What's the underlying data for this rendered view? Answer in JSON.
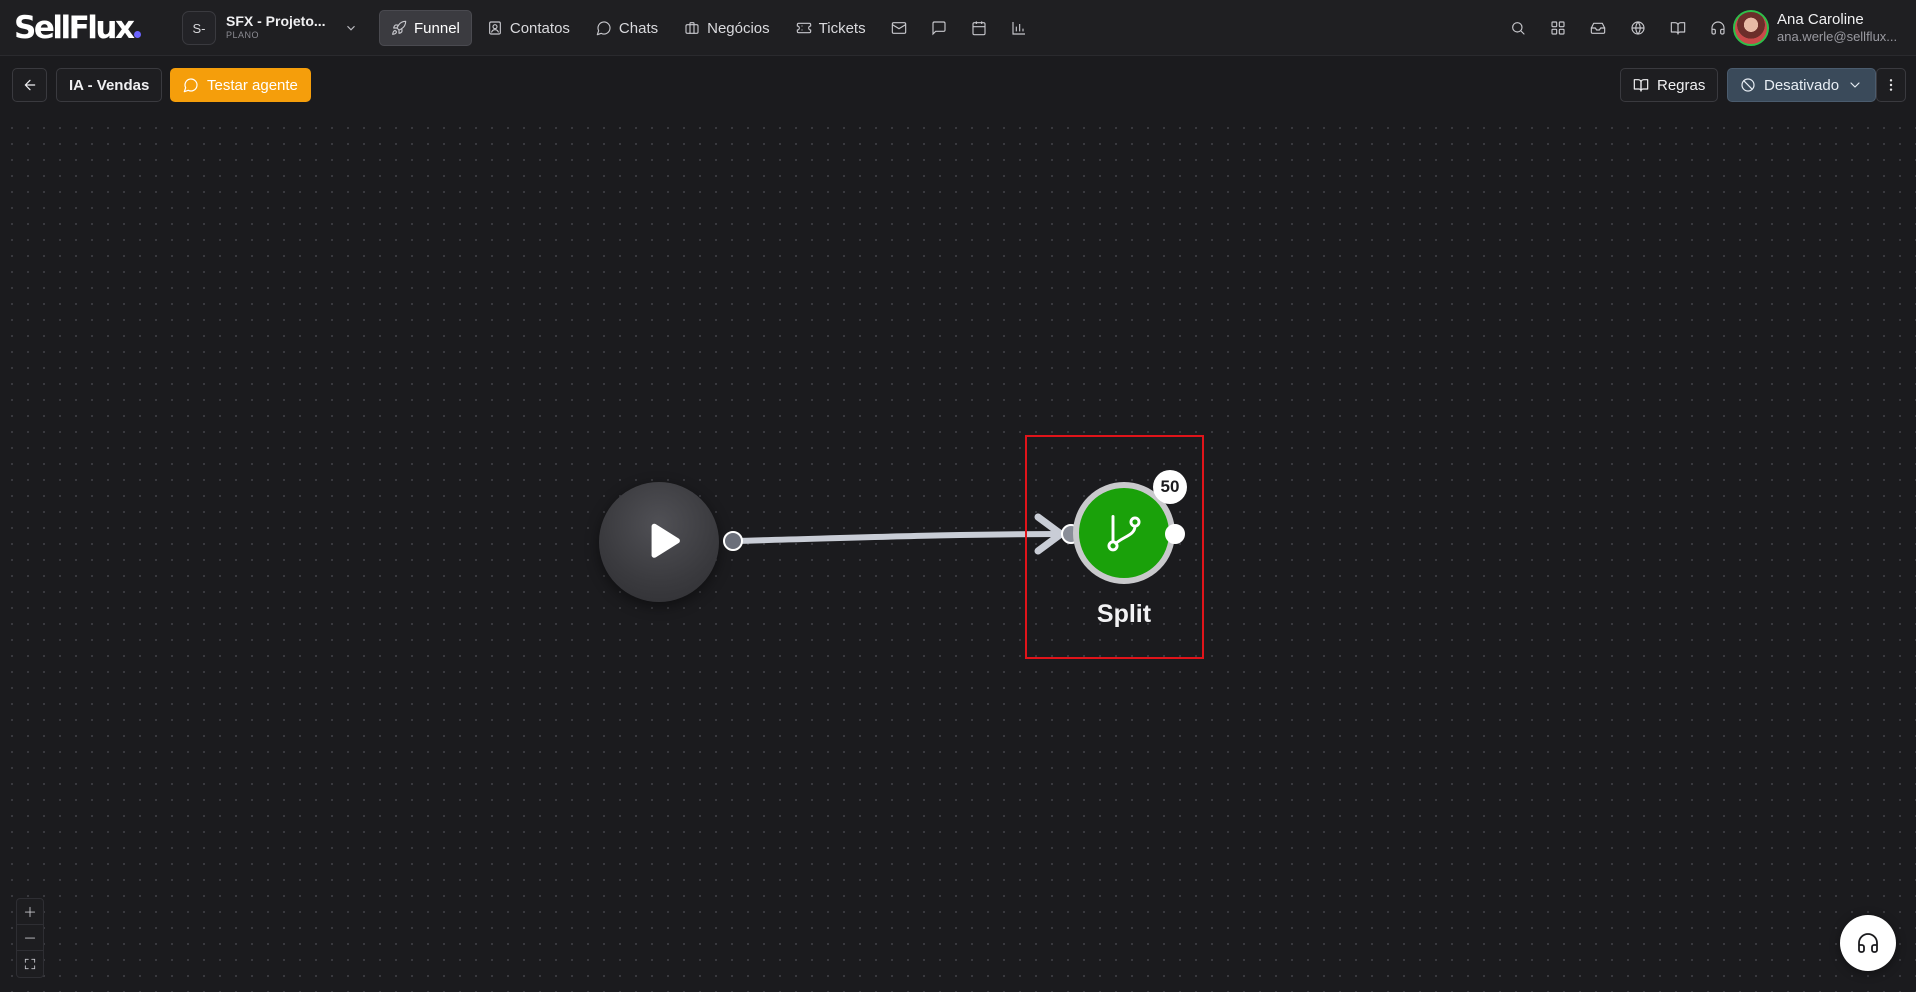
{
  "brand": {
    "logo_text": "SellFlux"
  },
  "workspace": {
    "initial": "S-",
    "name": "SFX - Projeto...",
    "plan": "PLANO"
  },
  "nav": {
    "items": [
      {
        "label": "Funnel",
        "icon": "rocket-icon",
        "active": true
      },
      {
        "label": "Contatos",
        "icon": "contacts-icon"
      },
      {
        "label": "Chats",
        "icon": "chat-bubble-icon"
      },
      {
        "label": "Negócios",
        "icon": "briefcase-icon"
      },
      {
        "label": "Tickets",
        "icon": "ticket-icon"
      }
    ],
    "icon_items": [
      "mail-icon",
      "message-square-icon",
      "calendar-icon",
      "bar-chart-icon"
    ]
  },
  "header_icons": [
    "search-icon",
    "apps-grid-icon",
    "inbox-icon",
    "globe-icon",
    "book-icon",
    "headset-icon"
  ],
  "user": {
    "name": "Ana Caroline",
    "email": "ana.werle@sellflux..."
  },
  "toolbar": {
    "title": "IA - Vendas",
    "test_label": "Testar agente",
    "rules_label": "Regras",
    "status_label": "Desativado"
  },
  "flow": {
    "start_node": {
      "icon": "play-icon"
    },
    "split_node": {
      "label": "Split",
      "badge": "50",
      "icon": "git-branch-icon",
      "color": "#1aa10a"
    }
  },
  "colors": {
    "accent_orange": "#f59e0b",
    "split_green": "#1aa10a",
    "selection_red": "#e0141a",
    "status_bg": "#3a4a5a"
  }
}
